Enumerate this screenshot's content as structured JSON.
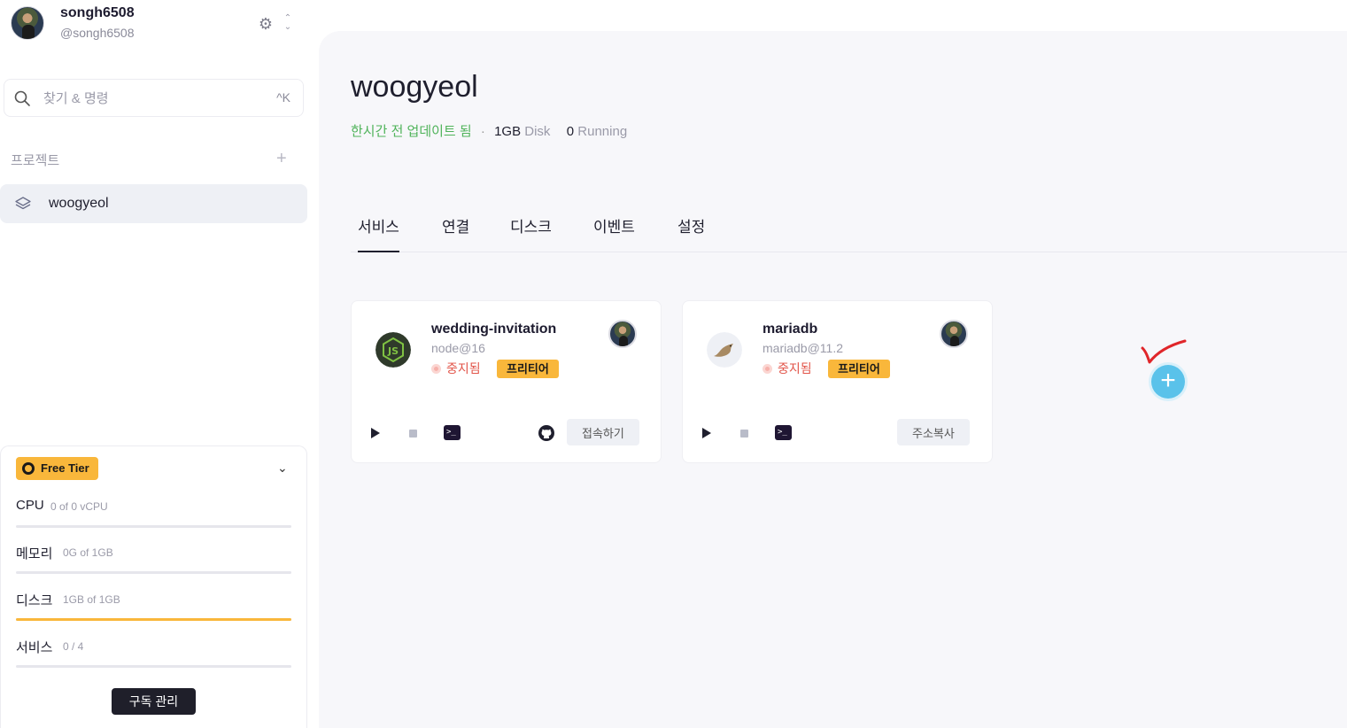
{
  "user": {
    "name": "songh6508",
    "handle": "@songh6508"
  },
  "search": {
    "placeholder": "찾기 & 명령",
    "shortcut": "^K"
  },
  "sidebar": {
    "projects_label": "프로젝트",
    "projects": [
      {
        "label": "woogyeol"
      }
    ]
  },
  "usage": {
    "tier": "Free Tier",
    "metrics": [
      {
        "name": "CPU",
        "value": "0 of 0 vCPU",
        "fill": 0
      },
      {
        "name": "메모리",
        "value": "0G of 1GB",
        "fill": 0
      },
      {
        "name": "디스크",
        "value": "1GB of 1GB",
        "fill": 1
      },
      {
        "name": "서비스",
        "value": "0 / 4",
        "fill": 0
      }
    ],
    "manage_label": "구독 관리"
  },
  "project": {
    "title": "woogyeol",
    "updated": "한시간 전 업데이트 됨",
    "separator": "·",
    "disk_num": "1GB",
    "disk_unit": "Disk",
    "running_num": "0",
    "running_unit": "Running"
  },
  "tabs": [
    {
      "label": "서비스",
      "active": true
    },
    {
      "label": "연결"
    },
    {
      "label": "디스크"
    },
    {
      "label": "이벤트"
    },
    {
      "label": "설정"
    }
  ],
  "services": [
    {
      "name": "wedding-invitation",
      "version": "node@16",
      "status": "중지됨",
      "tier": "프리티어",
      "icon": "nodejs-icon",
      "action": "접속하기"
    },
    {
      "name": "mariadb",
      "version": "mariadb@11.2",
      "status": "중지됨",
      "tier": "프리티어",
      "icon": "mariadb-icon",
      "action": "주소복사"
    }
  ],
  "colors": {
    "accent": "#f9b73b",
    "add": "#5ac2ea",
    "updated": "#4fb35a",
    "stopped": "#e2554a"
  }
}
